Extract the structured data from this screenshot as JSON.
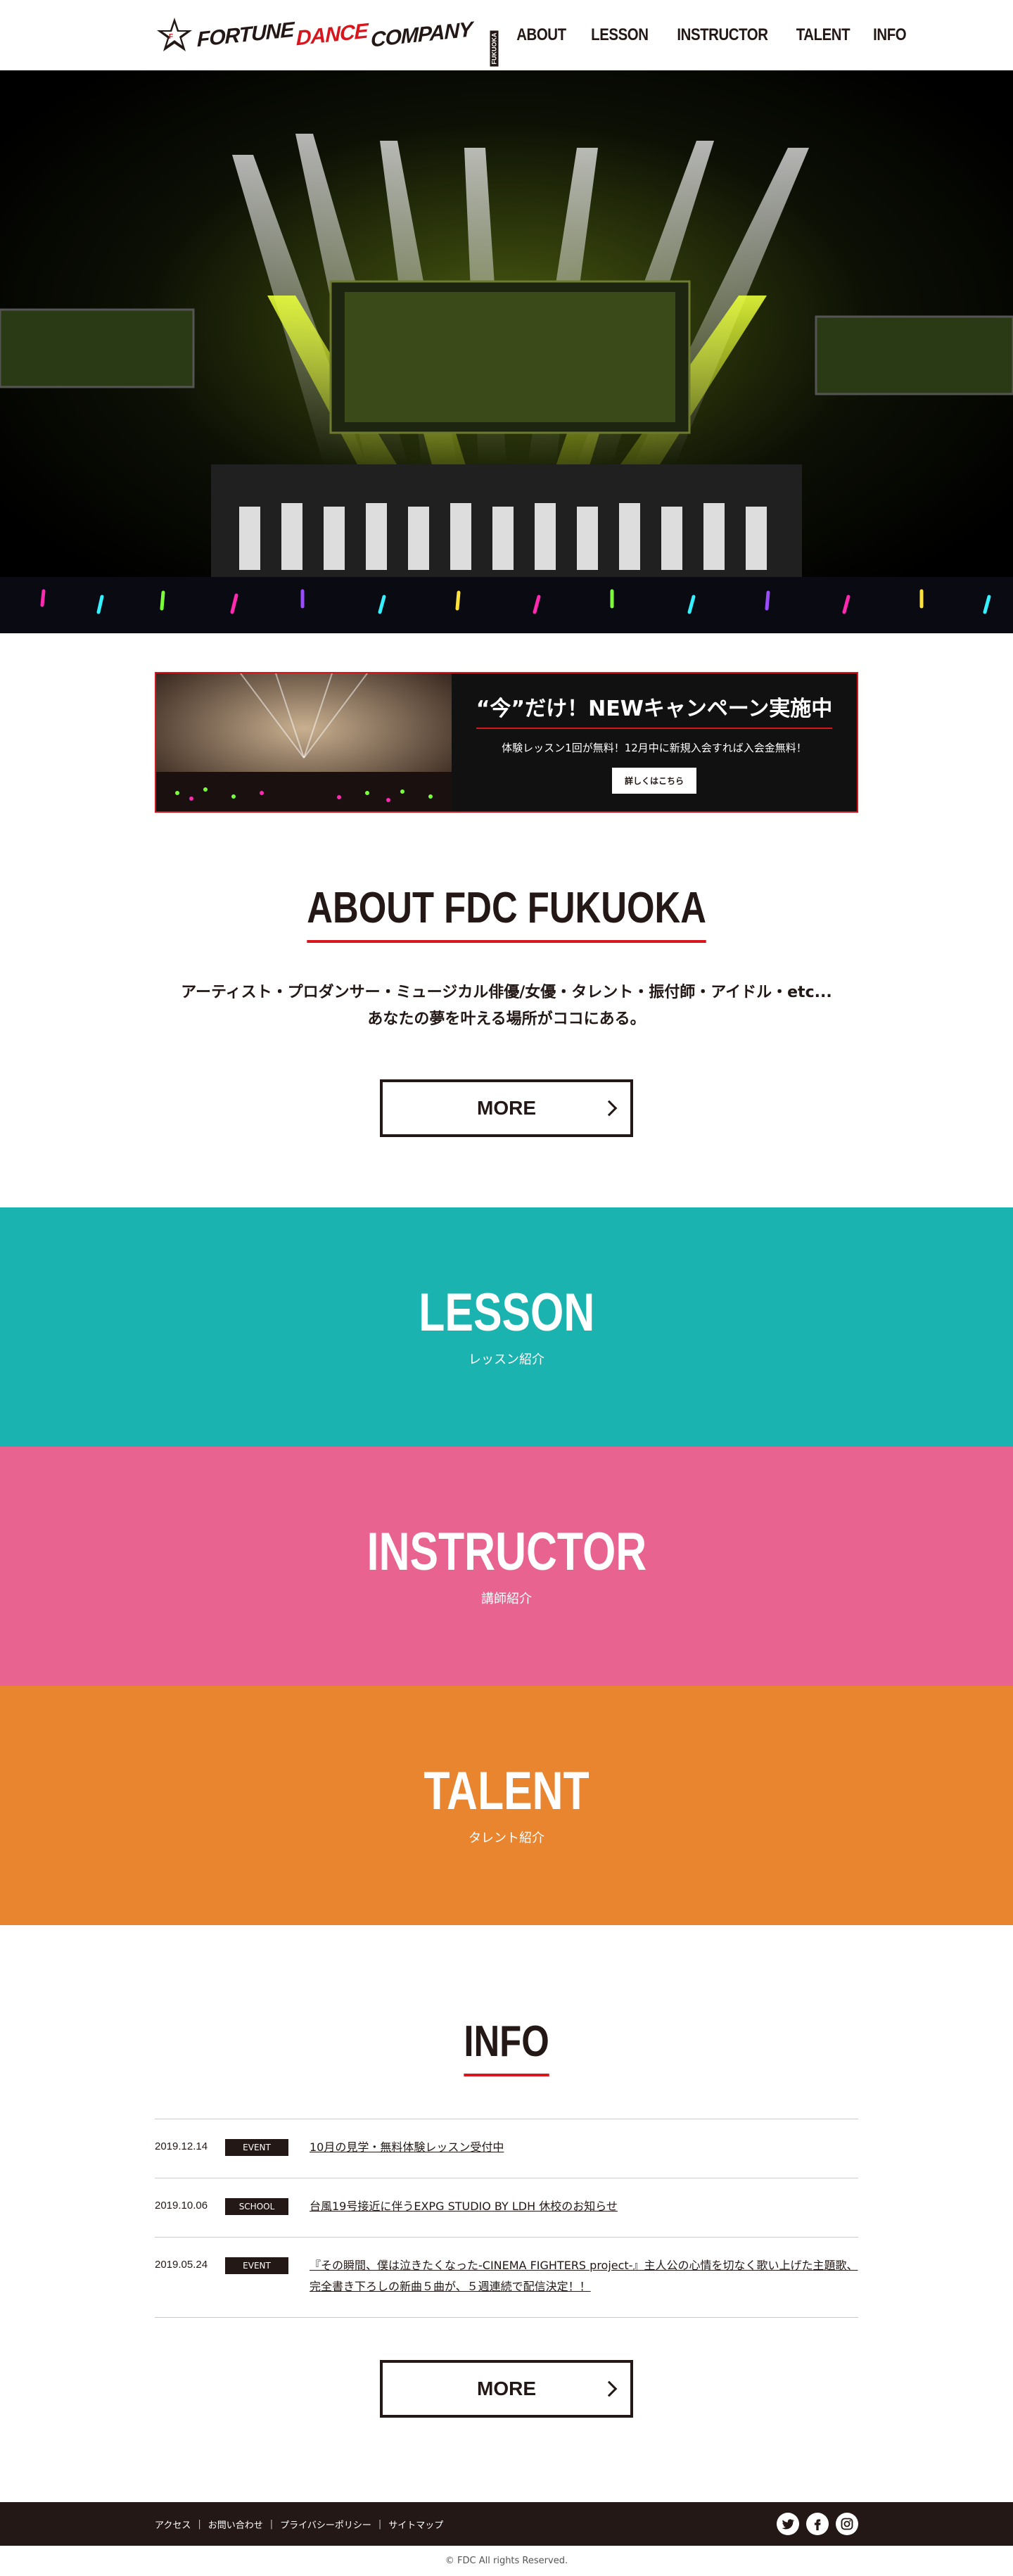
{
  "header": {
    "logo": {
      "word1": "FORTUNE",
      "word2": "DANCE",
      "word3": "COMPANY",
      "tag": "FUKUOKA"
    },
    "nav": [
      "ABOUT",
      "LESSON",
      "INSTRUCTOR",
      "TALENT",
      "INFO"
    ]
  },
  "banner": {
    "title": "“今”だけ！NEWキャンペーン実施中",
    "subtitle": "体験レッスン1回が無料！12月中に新規入会すれば入会金無料！",
    "button": "詳しくはこちら"
  },
  "about": {
    "title": "ABOUT FDC FUKUOKA",
    "line1": "アーティスト・プロダンサー・ミュージカル俳優/女優・タレント・振付師・アイドル・etc...",
    "line2": "あなたの夢を叶える場所がココにある。",
    "more": "MORE"
  },
  "panels": [
    {
      "title": "LESSON",
      "subtitle": "レッスン紹介",
      "color": "#1bb3af"
    },
    {
      "title": "INSTRUCTOR",
      "subtitle": "講師紹介",
      "color": "#e96391"
    },
    {
      "title": "TALENT",
      "subtitle": "タレント紹介",
      "color": "#ea852f"
    }
  ],
  "info": {
    "title": "INFO",
    "items": [
      {
        "date": "2019.12.14",
        "category": "EVENT",
        "text": "10月の見学・無料体験レッスン受付中"
      },
      {
        "date": "2019.10.06",
        "category": "SCHOOL",
        "text": "台風19号接近に伴うEXPG STUDIO BY LDH 休校のお知らせ"
      },
      {
        "date": "2019.05.24",
        "category": "EVENT",
        "text": "『その瞬間、僕は泣きたくなった-CINEMA FIGHTERS project-』主人公の心情を切なく歌い上げた主題歌、完全書き下ろしの新曲５曲が、５週連続で配信決定！！"
      }
    ],
    "more": "MORE"
  },
  "footer": {
    "links": [
      "アクセス",
      "お問い合わせ",
      "プライバシーポリシー",
      "サイトマップ"
    ],
    "social": [
      "twitter-icon",
      "facebook-icon",
      "instagram-icon"
    ],
    "copyright": "© FDC All rights Reserved."
  },
  "colors": {
    "accent": "#d7161e",
    "dark": "#231815"
  }
}
